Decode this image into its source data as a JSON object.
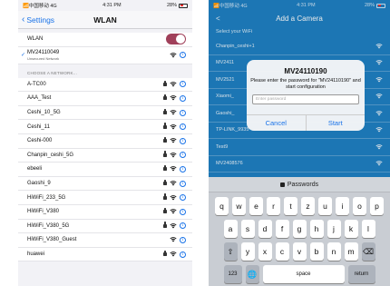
{
  "left_phone": {
    "status": {
      "carrier": "📶中国移动 4G",
      "time": "4:31 PM",
      "battery": "28%"
    },
    "nav": {
      "back_label": "Settings",
      "title": "WLAN"
    },
    "wlan_label": "WLAN",
    "wlan_on": true,
    "connected": {
      "name": "MV24110049",
      "subtitle": "Unsecured Network"
    },
    "section_header": "CHOOSE A NETWORK...",
    "networks": [
      {
        "name": "A-TC00",
        "locked": true
      },
      {
        "name": "AAA_Test",
        "locked": true
      },
      {
        "name": "Ceshi_10_5G",
        "locked": true
      },
      {
        "name": "Ceshi_11",
        "locked": true
      },
      {
        "name": "Ceshi-000",
        "locked": true
      },
      {
        "name": "Chanpin_ceshi_5G",
        "locked": true
      },
      {
        "name": "ebeeli",
        "locked": true
      },
      {
        "name": "Gaoshi_9",
        "locked": true
      },
      {
        "name": "HiWiFi_233_5G",
        "locked": true
      },
      {
        "name": "HiWiFi_V380",
        "locked": true
      },
      {
        "name": "HiWiFi_V380_5G",
        "locked": true
      },
      {
        "name": "HiWiFi_V380_Guest",
        "locked": false
      },
      {
        "name": "huawei",
        "locked": true
      }
    ]
  },
  "right_phone": {
    "status": {
      "carrier": "📶中国移动 4G",
      "time": "4:31 PM",
      "battery": "28%"
    },
    "nav": {
      "back_label": "<",
      "title": "Add a Camera"
    },
    "select_label": "Select your WiFi",
    "wifi_list": [
      "Chanpin_ceshi+1",
      "MV2411",
      "MV2521",
      "Xiaomi_",
      "Gaoshi_",
      "TP-LINK_9935",
      "Test9",
      "MV2408576"
    ],
    "dialog": {
      "title": "MV24110190",
      "message": "Please enter the password for \"MV24110190\" and start configuration",
      "input_placeholder": "Enter password",
      "cancel_label": "Cancel",
      "start_label": "Start"
    },
    "keyboard": {
      "bar_label": "Passwords",
      "row1": [
        "q",
        "w",
        "e",
        "r",
        "t",
        "z",
        "u",
        "i",
        "o",
        "p"
      ],
      "row2": [
        "a",
        "s",
        "d",
        "f",
        "g",
        "h",
        "j",
        "k",
        "l"
      ],
      "row3": [
        "y",
        "x",
        "c",
        "v",
        "b",
        "n",
        "m"
      ],
      "shift": "⇧",
      "delete": "⌫",
      "numbers": "123",
      "globe": "🌐",
      "space": "space",
      "return": "return"
    }
  },
  "colors": {
    "ios_blue": "#1a73e8",
    "app_blue": "#1f80c4",
    "toggle": "#a0405a"
  }
}
